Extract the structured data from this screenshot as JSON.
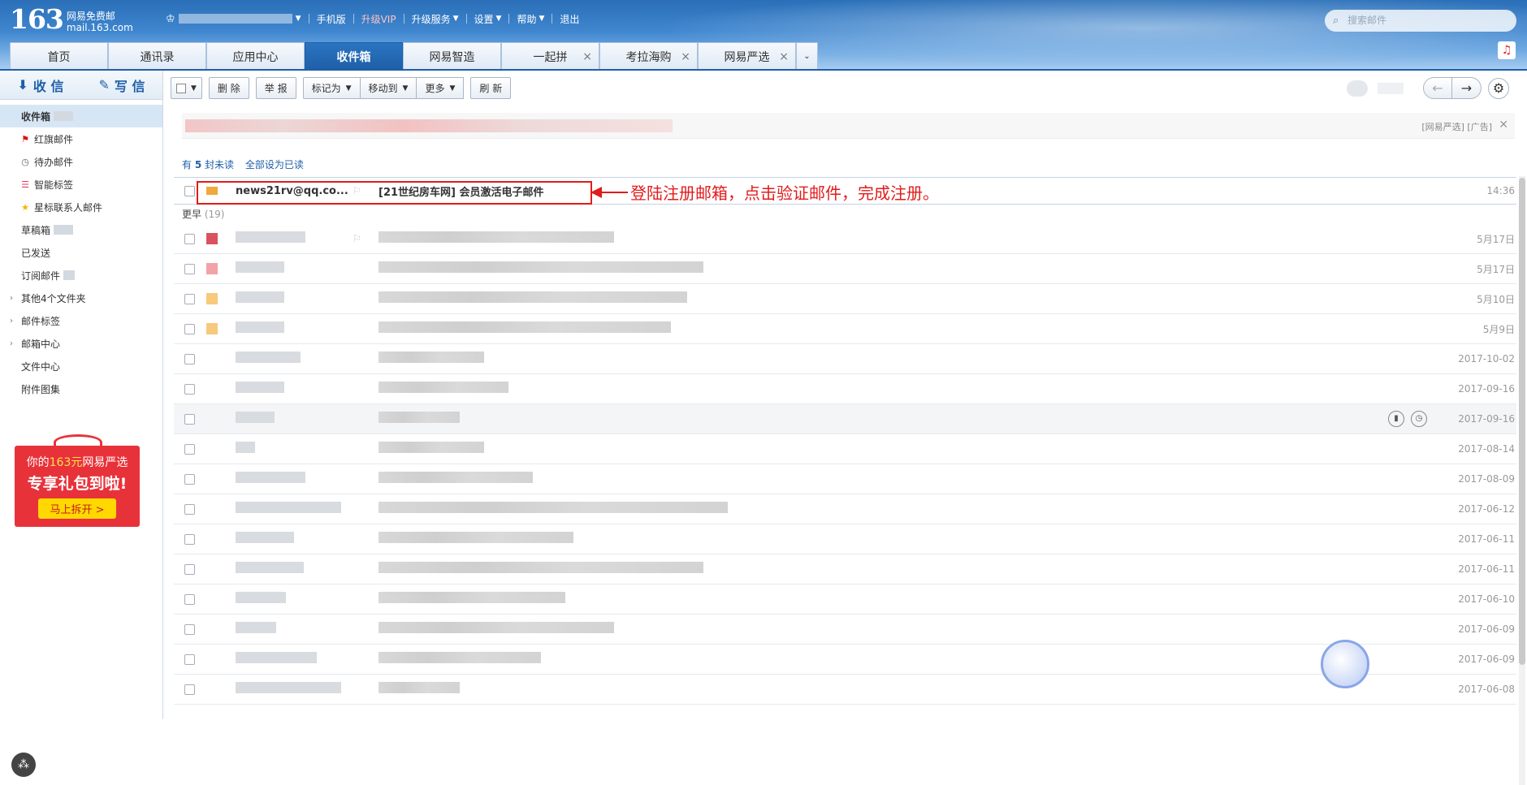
{
  "header": {
    "logo_num": "163",
    "logo_name": "网易免费邮",
    "logo_domain": "mail.163.com",
    "links": [
      "手机版",
      "升级VIP",
      "升级服务",
      "设置",
      "帮助",
      "退出"
    ],
    "search_placeholder": "搜索邮件"
  },
  "tabs": [
    "首页",
    "通讯录",
    "应用中心",
    "收件箱",
    "网易智造",
    "一起拼",
    "考拉海购",
    "网易严选"
  ],
  "sidebar": {
    "receive": "收 信",
    "compose": "写 信",
    "folders": [
      "收件箱",
      "红旗邮件",
      "待办邮件",
      "智能标签",
      "星标联系人邮件",
      "草稿箱",
      "已发送",
      "订阅邮件",
      "其他4个文件夹",
      "邮件标签",
      "邮箱中心",
      "文件中心",
      "附件图集"
    ]
  },
  "promo": {
    "prefix": "你的",
    "amount": "163元",
    "suffix": "网易严选",
    "line2": "专享礼包到啦!",
    "button": "马上拆开 >"
  },
  "toolbar": {
    "delete": "删 除",
    "report": "举 报",
    "markas": "标记为",
    "moveto": "移动到",
    "more": "更多",
    "refresh": "刷 新"
  },
  "ad": {
    "label": "[网易严选] [广告]",
    "close": "✕"
  },
  "unread": {
    "prefix": "有",
    "count": "5",
    "suffix": "封未读",
    "mark_all": "全部设为已读"
  },
  "new_mail": {
    "sender": "news21rv@qq.co...",
    "subject": "[21世纪房车网] 会员激活电子邮件",
    "date": "14:36"
  },
  "section_earlier": {
    "label": "更早",
    "count": "(19)"
  },
  "earlier_dates": [
    "5月17日",
    "5月17日",
    "5月10日",
    "5月9日",
    "2017-10-02",
    "2017-09-16",
    "2017-09-16",
    "2017-08-14",
    "2017-08-09",
    "2017-06-12",
    "2017-06-11",
    "2017-06-11",
    "2017-06-10",
    "2017-06-09",
    "2017-06-09",
    "2017-06-08"
  ],
  "annotation": "登陆注册邮箱，点击验证邮件，完成注册。",
  "colors": {
    "brand": "#1e5fa8",
    "annotation": "#e21b1b"
  }
}
